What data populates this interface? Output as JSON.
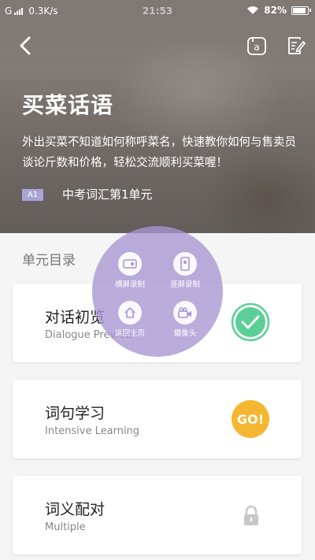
{
  "status_bar": {
    "carrier": "G",
    "speed": "0.3K/s",
    "time": "21:53",
    "battery": "82%"
  },
  "header": {
    "title": "买菜话语",
    "description": "外出买菜不知道如何称呼菜名，快速教你如何与售卖员谈论斤数和价格，轻松交流顺利买菜喔！",
    "level": "A1",
    "unit_label": "中考词汇第1单元"
  },
  "section": {
    "title": "单元目录"
  },
  "cards": [
    {
      "title": "对话初览",
      "subtitle": "Dialogue Preview",
      "status": "completed"
    },
    {
      "title": "词句学习",
      "subtitle": "Intensive Learning",
      "status": "go",
      "status_label": "GO!"
    },
    {
      "title": "词义配对",
      "subtitle": "Multiple",
      "status": "locked"
    }
  ],
  "float_menu": {
    "items": [
      {
        "label": "横屏录制",
        "icon": "landscape-record-icon"
      },
      {
        "label": "竖屏录制",
        "icon": "portrait-record-icon"
      },
      {
        "label": "返回主页",
        "icon": "home-icon"
      },
      {
        "label": "摄像头",
        "icon": "camera-icon"
      }
    ]
  },
  "colors": {
    "accent_purple": "#a9a4d4",
    "check_green": "#5ccf96",
    "go_yellow": "#f5b731",
    "lock_gray": "#c8c8c8"
  }
}
